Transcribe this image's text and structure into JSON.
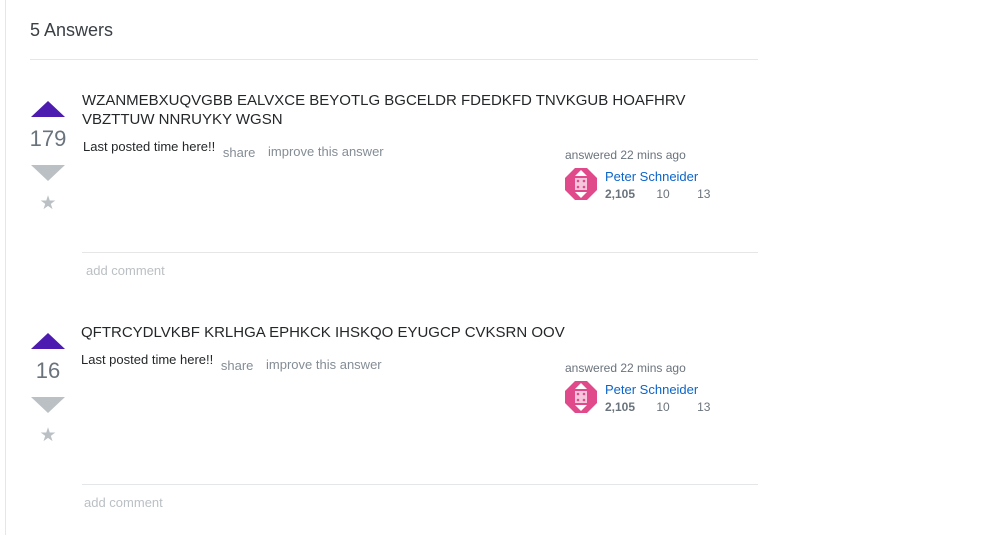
{
  "header": {
    "answers_count_label": "5 Answers"
  },
  "colors": {
    "vote_up": "#4e1bb0",
    "vote_inactive": "#bbc0c4",
    "user_link": "#0c65c9",
    "avatar": "#e0498a"
  },
  "answers": [
    {
      "votes": "179",
      "body": "WZANMEBXUQVGBB EALVXCE BEYOTLG BGCELDR FDEDKFD TNVKGUB HOAFHRV VBZTTUW NNRUYKY WGSN",
      "posted_time": "Last posted time here!!",
      "share_label": "share",
      "improve_label": "improve this answer",
      "answered_label": "answered 22 mins ago",
      "user": {
        "name": "Peter Schneider",
        "reputation": "2,105",
        "silver_badges": "10",
        "bronze_badges": "13",
        "avatar_icon": "identicon-avatar"
      },
      "add_comment_label": "add comment"
    },
    {
      "votes": "16",
      "body": "QFTRCYDLVKBF KRLHGA EPHKCK IHSKQO EYUGCP CVKSRN OOV",
      "posted_time": "Last posted time here!!",
      "share_label": "share",
      "improve_label": "improve this answer",
      "answered_label": "answered 22 mins ago",
      "user": {
        "name": "Peter Schneider",
        "reputation": "2,105",
        "silver_badges": "10",
        "bronze_badges": "13",
        "avatar_icon": "identicon-avatar"
      },
      "add_comment_label": "add comment"
    }
  ]
}
